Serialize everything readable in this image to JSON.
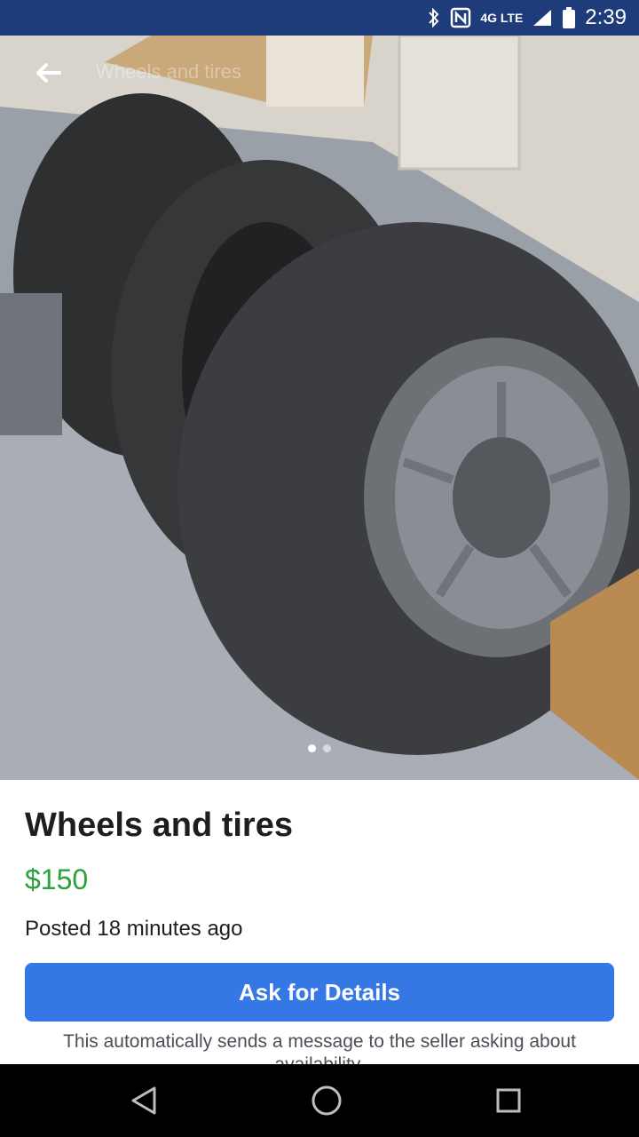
{
  "status_bar": {
    "time": "2:39",
    "network": "4G LTE",
    "icons": [
      "bluetooth-icon",
      "nfc-icon",
      "signal-icon",
      "battery-icon"
    ]
  },
  "photo": {
    "header_title": "Wheels and tires",
    "image_count": 2,
    "active_index": 0
  },
  "listing": {
    "title": "Wheels and tires",
    "price": "$150",
    "posted": "Posted 18 minutes ago",
    "ask_button": "Ask for Details",
    "note": "This automatically sends a message to the seller asking about availability."
  },
  "nav": {
    "icons": [
      "back-triangle-icon",
      "home-circle-icon",
      "recents-square-icon"
    ]
  },
  "colors": {
    "status_bar": "#1e3c79",
    "price": "#2aa13c",
    "button": "#3578e5"
  }
}
